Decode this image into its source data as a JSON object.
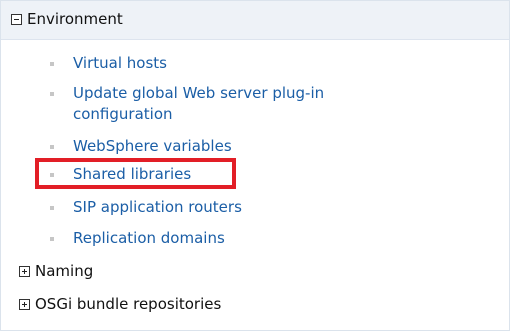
{
  "section": {
    "title": "Environment",
    "toggle_icon": "collapse-icon",
    "links": [
      {
        "label": "Virtual hosts"
      },
      {
        "label": "Update global Web server plug-in",
        "label_line2": "configuration"
      },
      {
        "label": "WebSphere variables"
      },
      {
        "label": "Shared libraries",
        "highlighted": true
      },
      {
        "label": "SIP application routers"
      },
      {
        "label": "Replication domains"
      }
    ]
  },
  "collapsed_sections": [
    {
      "label": "Naming",
      "toggle_icon": "expand-icon"
    },
    {
      "label": "OSGi bundle repositories",
      "toggle_icon": "expand-icon"
    }
  ],
  "colors": {
    "header_background": "#eef2f7",
    "link": "#1b5ea6",
    "highlight": "#e21e26",
    "bullet": "#c6c6c6"
  }
}
